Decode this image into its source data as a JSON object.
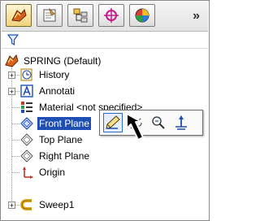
{
  "toolbar": {
    "tabs": [
      {
        "icon": "feature-manager-icon",
        "active": true
      },
      {
        "icon": "property-manager-icon",
        "active": false
      },
      {
        "icon": "configuration-manager-icon",
        "active": false
      },
      {
        "icon": "dimxpert-icon",
        "active": false
      },
      {
        "icon": "display-manager-icon",
        "active": false
      }
    ],
    "overflow_label": "»"
  },
  "filter": {
    "icon": "filter-icon"
  },
  "tree": {
    "root": {
      "label": "SPRING  (Default)",
      "icon": "part-icon"
    },
    "items": [
      {
        "label": "History",
        "icon": "history-icon",
        "expandable": true
      },
      {
        "label": "Annotati",
        "icon": "annotations-icon",
        "expandable": true
      },
      {
        "label": "Material <not specified>",
        "icon": "material-icon",
        "expandable": false
      },
      {
        "label": "Front Plane",
        "icon": "plane-icon",
        "expandable": false,
        "selected": true
      },
      {
        "label": "Top Plane",
        "icon": "plane-icon",
        "expandable": false
      },
      {
        "label": "Right Plane",
        "icon": "plane-icon",
        "expandable": false
      },
      {
        "label": "Origin",
        "icon": "origin-icon",
        "expandable": false
      },
      {
        "label": "Sweep1",
        "icon": "sweep-icon",
        "expandable": true
      }
    ]
  },
  "context_toolbar": {
    "buttons": [
      {
        "icon": "edit-sketch-icon"
      },
      {
        "icon": "hide-show-icon"
      },
      {
        "icon": "zoom-to-selection-icon"
      },
      {
        "icon": "normal-to-icon"
      }
    ]
  },
  "colors": {
    "selection": "#1f4fb5",
    "accent": "#f0d27a"
  }
}
